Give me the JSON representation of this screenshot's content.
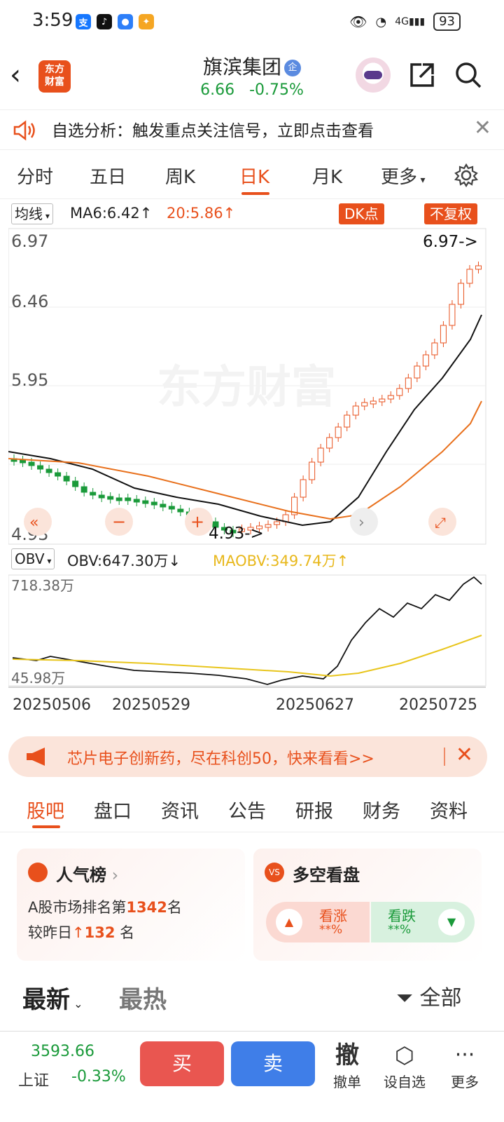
{
  "status_bar": {
    "time": "3:59",
    "battery": "93",
    "network": "4G"
  },
  "header": {
    "stock_name": "旗滨集团",
    "badge": "企",
    "price": "6.66",
    "change": "-0.75%",
    "logo_line1": "东方",
    "logo_line2": "财富"
  },
  "notice": {
    "text": "自选分析：触发重点关注信号，立即点击查看"
  },
  "tabs": [
    "分时",
    "五日",
    "周K",
    "日K",
    "月K",
    "更多"
  ],
  "ma_row": {
    "selector": "均线",
    "ma6": "MA6:6.42",
    "ma20": "20:5.86",
    "dk_button": "DK点",
    "fq_button": "不复权"
  },
  "chart": {
    "y_labels": [
      "6.97",
      "6.46",
      "5.95",
      "4.93"
    ],
    "high_annotation": "6.97->",
    "low_annotation": "4.93->",
    "watermark": "东方财富",
    "colors": {
      "up": "#e8501c",
      "down": "#1a9a3a",
      "ma_black": "#111111",
      "ma_orange": "#e8701c",
      "obv_avg": "#e8c51c"
    }
  },
  "obv_row": {
    "selector": "OBV",
    "obv": "OBV:647.30万",
    "maobv": "MAOBV:349.74万"
  },
  "obv_chart": {
    "top_label": "718.38万",
    "bottom_label": "45.98万"
  },
  "x_labels": [
    "20250506",
    "20250529",
    "20250627",
    "20250725"
  ],
  "promo": {
    "text": "芯片电子创新药，尽在科创50，快来看看>>"
  },
  "tabs2": [
    "股吧",
    "盘口",
    "资讯",
    "公告",
    "研报",
    "财务",
    "资料"
  ],
  "popularity": {
    "title": "人气榜",
    "line1_prefix": "A股市场排名第",
    "rank": "1342",
    "line1_suffix": "名",
    "line2_prefix": "较昨日",
    "delta": "132",
    "line2_suffix": "名"
  },
  "sentiment": {
    "title": "多空看盘",
    "up_label": "看涨",
    "up_value": "**%",
    "down_label": "看跌",
    "down_value": "**%"
  },
  "feed": {
    "latest": "最新",
    "hot": "最热",
    "filter": "全部"
  },
  "bottom_bar": {
    "index_value": "3593.66",
    "index_name": "上证",
    "index_change": "-0.33%",
    "buy": "买",
    "sell": "卖",
    "withdraw_icon": "撤",
    "withdraw": "撤单",
    "set_fav": "设自选",
    "more": "更多"
  }
}
